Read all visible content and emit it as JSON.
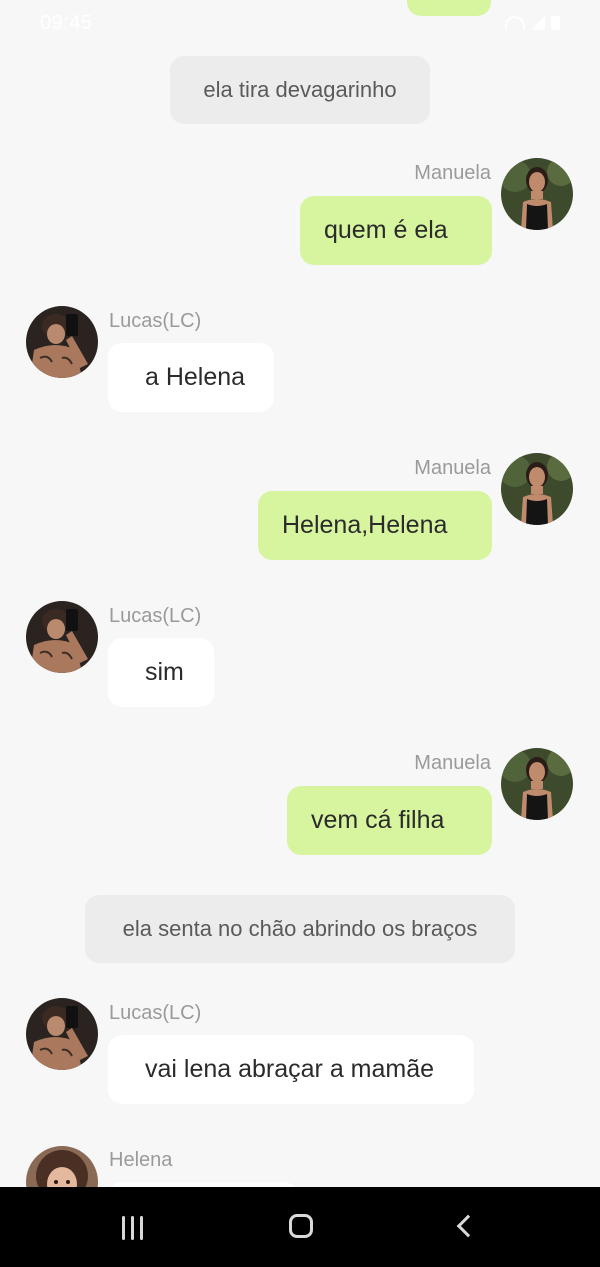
{
  "status_bar": {
    "time": "09:45"
  },
  "messages": [
    {
      "kind": "narration",
      "text": "ela tira devagarinho"
    },
    {
      "kind": "outgoing",
      "sender": "Manuela",
      "text": "quem é ela"
    },
    {
      "kind": "incoming",
      "sender": "Lucas(LC)",
      "text": "a Helena"
    },
    {
      "kind": "outgoing",
      "sender": "Manuela",
      "text": "Helena,Helena"
    },
    {
      "kind": "incoming",
      "sender": "Lucas(LC)",
      "text": "sim"
    },
    {
      "kind": "outgoing",
      "sender": "Manuela",
      "text": "vem cá filha"
    },
    {
      "kind": "narration",
      "text": "ela senta no chão abrindo os braços"
    },
    {
      "kind": "incoming",
      "sender": "Lucas(LC)",
      "text": "vai lena abraçar a mamãe"
    },
    {
      "kind": "incoming",
      "sender": "Helena",
      "text": ""
    }
  ],
  "colors": {
    "outgoing_bubble": "#d7f59f",
    "incoming_bubble": "#ffffff",
    "narration_bubble": "#ececec",
    "background": "#f7f7f7",
    "nav_bar": "#000000"
  },
  "nav_bar": {
    "icons": [
      "recent-apps-icon",
      "home-icon",
      "back-icon"
    ]
  }
}
